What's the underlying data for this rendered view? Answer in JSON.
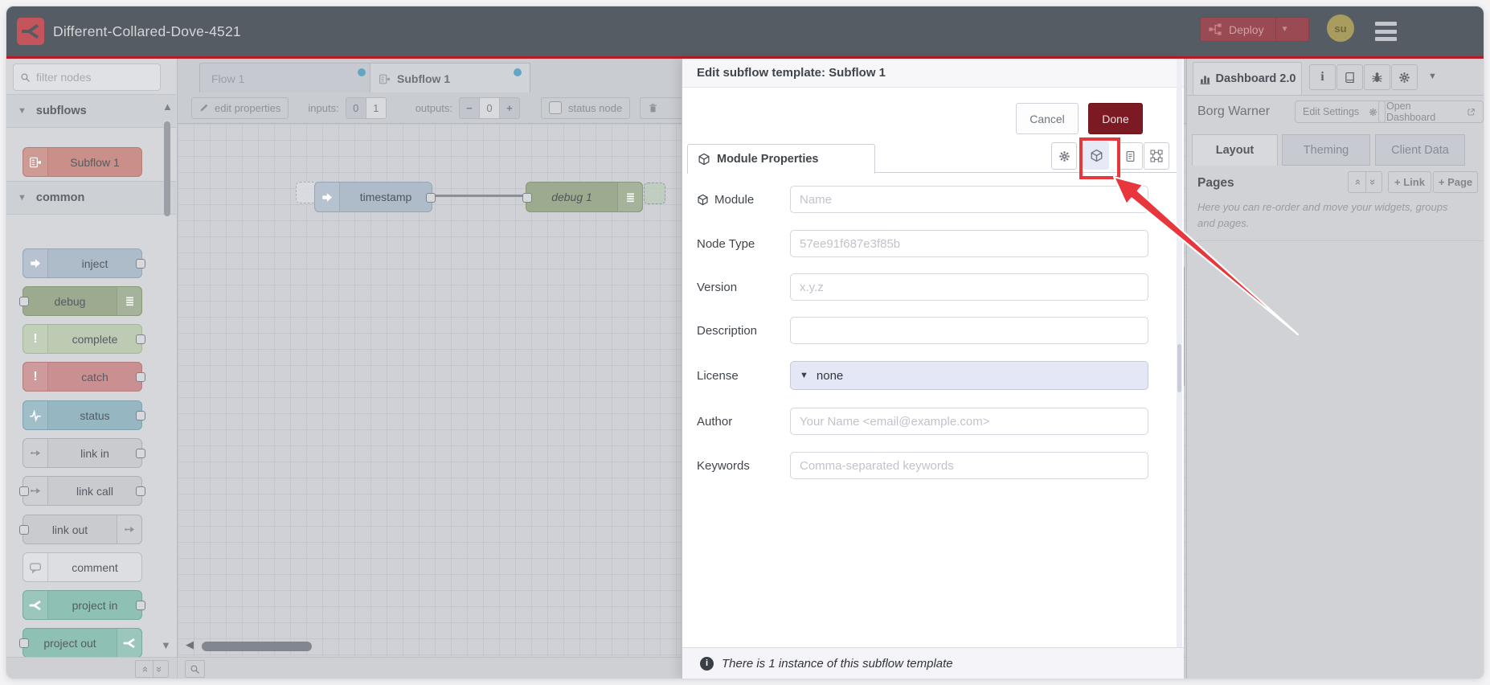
{
  "window": {
    "title": "Different-Collared-Dove-4521"
  },
  "header": {
    "deploy_label": "Deploy",
    "avatar_text": "su"
  },
  "palette": {
    "filter_placeholder": "filter nodes",
    "sections": [
      {
        "label": "subflows",
        "nodes": [
          {
            "label": "Subflow 1"
          }
        ]
      },
      {
        "label": "common",
        "nodes": [
          {
            "label": "inject"
          },
          {
            "label": "debug"
          },
          {
            "label": "complete"
          },
          {
            "label": "catch"
          },
          {
            "label": "status"
          },
          {
            "label": "link in"
          },
          {
            "label": "link call"
          },
          {
            "label": "link out"
          },
          {
            "label": "comment"
          },
          {
            "label": "project in"
          },
          {
            "label": "project out"
          }
        ]
      }
    ]
  },
  "workspace": {
    "tabs": [
      {
        "label": "Flow 1"
      },
      {
        "label": "Subflow 1"
      }
    ],
    "toolbar": {
      "edit_properties": "edit properties",
      "inputs_label": "inputs:",
      "inputs_options": [
        "0",
        "1"
      ],
      "outputs_label": "outputs:",
      "outputs_minus": "−",
      "outputs_value": "0",
      "outputs_plus": "+",
      "status_node_label": "status node"
    },
    "canvas": {
      "nodes": [
        {
          "label": "timestamp"
        },
        {
          "label": "debug 1"
        }
      ]
    }
  },
  "tray": {
    "title": "Edit subflow template: Subflow 1",
    "cancel_label": "Cancel",
    "done_label": "Done",
    "tab_label": "Module Properties",
    "form": {
      "rows": [
        {
          "label": "Module",
          "placeholder": "Name"
        },
        {
          "label": "Node Type",
          "placeholder": "57ee91f687e3f85b"
        },
        {
          "label": "Version",
          "placeholder": "x.y.z"
        },
        {
          "label": "Description",
          "placeholder": ""
        },
        {
          "label": "License",
          "value": "none"
        },
        {
          "label": "Author",
          "placeholder": "Your Name <email@example.com>"
        },
        {
          "label": "Keywords",
          "placeholder": "Comma-separated keywords"
        }
      ]
    },
    "footer_text": "There is 1 instance of this subflow template"
  },
  "sidebar": {
    "dashboard_tab": "Dashboard 2.0",
    "board_name": "Borg Warner",
    "edit_settings_label": "Edit Settings",
    "open_dashboard_label": "Open Dashboard",
    "tabs": [
      {
        "label": "Layout"
      },
      {
        "label": "Theming"
      },
      {
        "label": "Client Data"
      }
    ],
    "pages_label": "Pages",
    "link_button": "+ Link",
    "page_button": "+ Page",
    "help_text": "Here you can re-order and move your widgets, groups and pages."
  },
  "colors": {
    "accent_red": "#e8363d",
    "header_bg": "#565c63",
    "deploy_bg": "#9a4a52",
    "done_bg": "#7c1a24",
    "license_bg": "#e4e7f6",
    "tab_dot": "#63a6c4",
    "logo_bg": "#c4555c"
  }
}
